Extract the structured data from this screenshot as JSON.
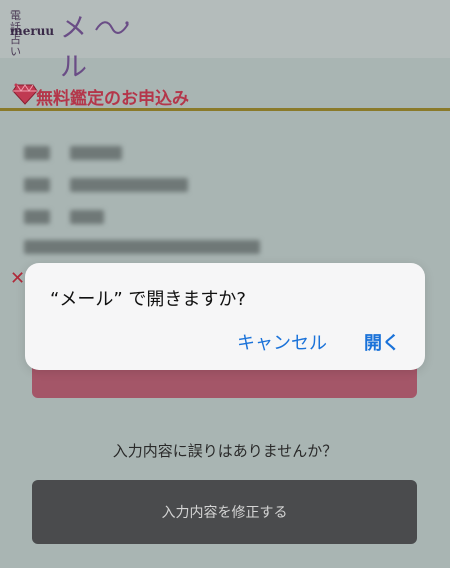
{
  "header": {
    "logo_small": "電話占い",
    "logo_en": "meruu",
    "logo_main": "メル"
  },
  "form": {
    "heading": "無料鑑定のお申込み",
    "confirm_question": "入力内容に誤りはありませんか？",
    "edit_button_label": "入力内容を修正する"
  },
  "dialog": {
    "message": "“メール” で開きますか?",
    "cancel_label": "キャンセル",
    "open_label": "開く"
  },
  "colors": {
    "accent": "#1a72d9",
    "heading": "#b4364a",
    "submit_button": "#a45668",
    "edit_button": "#4a4b4d"
  },
  "icons": {
    "heading_icon": "diamond-icon",
    "logo_decoration": "swirl-icon"
  }
}
